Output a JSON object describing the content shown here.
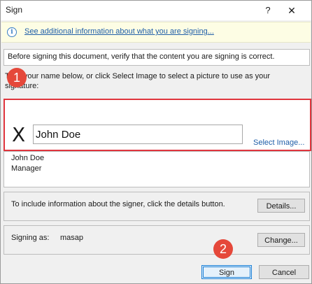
{
  "window": {
    "title": "Sign",
    "help_label": "?",
    "close_label": "✕"
  },
  "infobar": {
    "icon": "info-icon",
    "link_text": "See additional information about what you are signing..."
  },
  "verify_text": "Before signing this document, verify that the content you are signing is correct.",
  "instruction_text": "Type your name below, or click Select Image to select a picture to use as your signature:",
  "signature": {
    "x_mark": "X",
    "name_value": "John Doe",
    "select_image_label": "Select Image..."
  },
  "signer": {
    "name": "John Doe",
    "title": "Manager"
  },
  "details": {
    "text": "To include information about the signer, click the details button.",
    "button_label": "Details..."
  },
  "signing_as": {
    "label": "Signing as:",
    "user": "masap",
    "change_label": "Change..."
  },
  "footer": {
    "sign_label": "Sign",
    "cancel_label": "Cancel"
  },
  "annotations": {
    "badge1": "1",
    "badge2": "2",
    "highlight_color": "#e0353d"
  }
}
